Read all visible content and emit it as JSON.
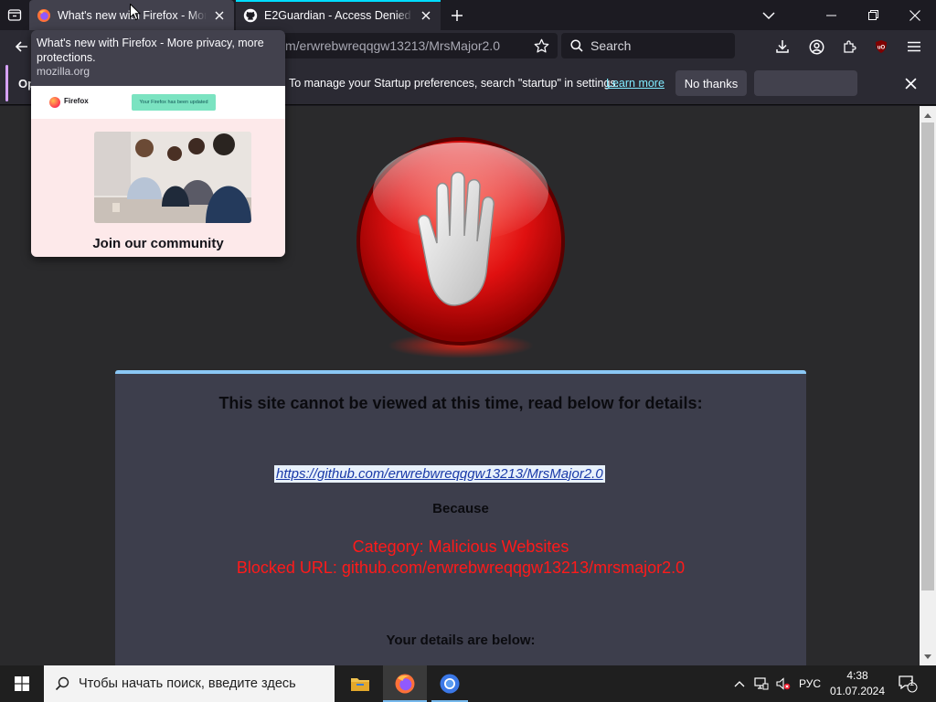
{
  "tabs": [
    {
      "title": "What's new with Firefox - More privacy, more protections.",
      "active": false
    },
    {
      "title": "E2Guardian - Access Denied",
      "active": true
    }
  ],
  "address_bar": {
    "url_visible": "m/erwrebwreqqgw13213/MrsMajor2.0"
  },
  "search_bar": {
    "placeholder": "Search"
  },
  "notification": {
    "lead": "Op",
    "message": "To manage your Startup preferences, search \"startup\" in settings.",
    "learn_more": "Learn more",
    "no_thanks": "No thanks"
  },
  "tab_preview": {
    "title": "What's new with Firefox - More privacy, more protections.",
    "domain": "mozilla.org",
    "thumb_brand": "Firefox",
    "thumb_badge": "Your Firefox has been updated",
    "thumb_caption": "Join our community"
  },
  "block_page": {
    "heading": "This site cannot be viewed at this time, read below for details:",
    "blocked_url": "https://github.com/erwrebwreqqgw13213/MrsMajor2.0",
    "because": "Because",
    "category": "Category: Malicious Websites",
    "blocked_line": "Blocked URL: github.com/erwrebwreqqgw13213/mrsmajor2.0",
    "details": "Your details are below:"
  },
  "taskbar": {
    "search_placeholder": "Чтобы начать поиск, введите здесь",
    "language": "РУС",
    "time": "4:38",
    "date": "01.07.2024",
    "notification_count": "1"
  },
  "colors": {
    "accent_blue": "#00ddff",
    "warning_red": "#ff1a1a",
    "panel_bg": "#3d3e4c"
  }
}
